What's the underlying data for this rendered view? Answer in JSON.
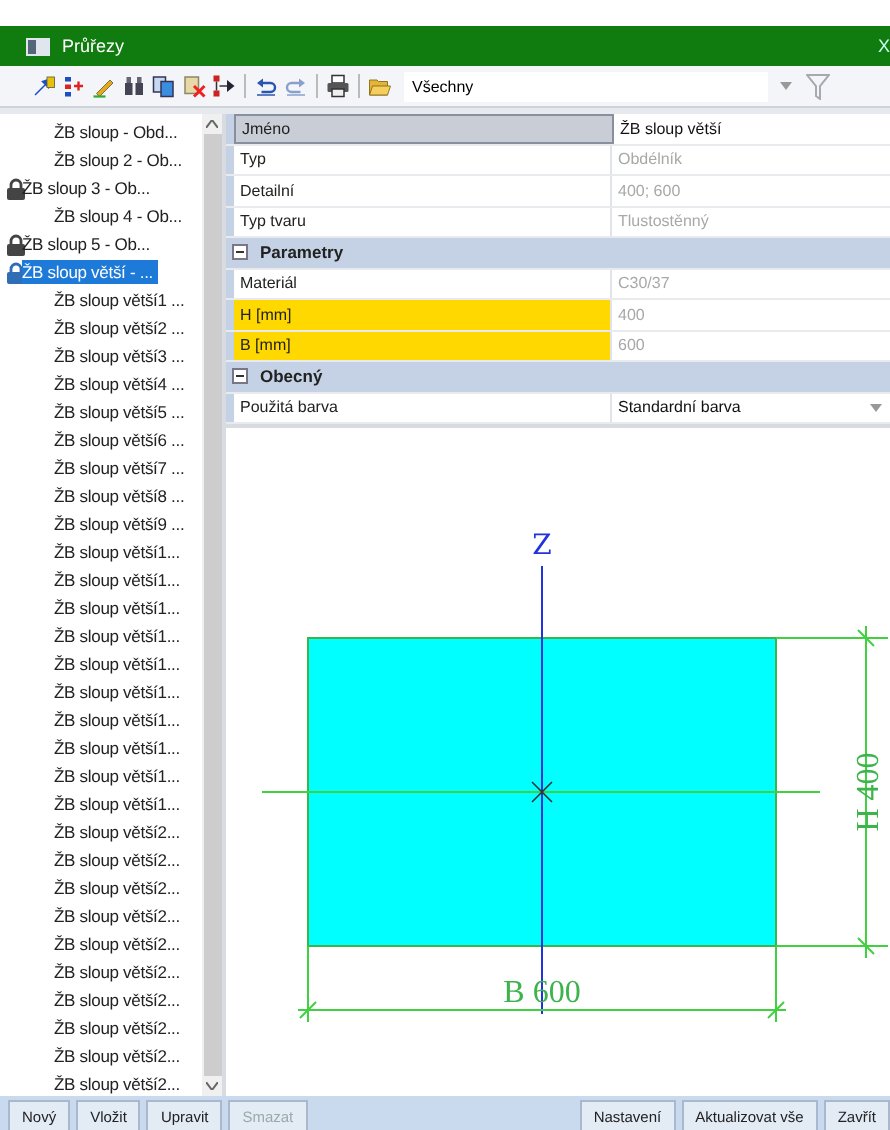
{
  "window": {
    "title": "Průřezy",
    "close": "X"
  },
  "toolbar": {
    "icons": [
      {
        "kind": "pin"
      },
      {
        "kind": "split"
      },
      {
        "kind": "pencil"
      },
      {
        "kind": "binoculars"
      },
      {
        "kind": "copy"
      },
      {
        "kind": "delete"
      },
      {
        "kind": "tree"
      },
      {
        "kind": "sep"
      },
      {
        "kind": "undo"
      },
      {
        "kind": "redo"
      },
      {
        "kind": "sep"
      },
      {
        "kind": "printer"
      },
      {
        "kind": "sep"
      },
      {
        "kind": "folder"
      }
    ],
    "filter": {
      "value": "Všechny"
    }
  },
  "list": [
    {
      "label": "ŽB sloup - Obd...",
      "locked": false,
      "selected": false
    },
    {
      "label": "ŽB sloup 2 - Ob...",
      "locked": false,
      "selected": false
    },
    {
      "label": "ŽB sloup 3 - Ob...",
      "locked": true,
      "selected": false
    },
    {
      "label": "ŽB sloup 4 - Ob...",
      "locked": false,
      "selected": false
    },
    {
      "label": "ŽB sloup 5 - Ob...",
      "locked": true,
      "selected": false
    },
    {
      "label": "ŽB sloup větší - ...",
      "locked": true,
      "selected": true
    },
    {
      "label": "ŽB sloup větší1 ...",
      "locked": false,
      "selected": false
    },
    {
      "label": "ŽB sloup větší2 ...",
      "locked": false,
      "selected": false
    },
    {
      "label": "ŽB sloup větší3 ...",
      "locked": false,
      "selected": false
    },
    {
      "label": "ŽB sloup větší4 ...",
      "locked": false,
      "selected": false
    },
    {
      "label": "ŽB sloup větší5 ...",
      "locked": false,
      "selected": false
    },
    {
      "label": "ŽB sloup větší6 ...",
      "locked": false,
      "selected": false
    },
    {
      "label": "ŽB sloup větší7 ...",
      "locked": false,
      "selected": false
    },
    {
      "label": "ŽB sloup větší8 ...",
      "locked": false,
      "selected": false
    },
    {
      "label": "ŽB sloup větší9 ...",
      "locked": false,
      "selected": false
    },
    {
      "label": "ŽB sloup větší1...",
      "locked": false,
      "selected": false
    },
    {
      "label": "ŽB sloup větší1...",
      "locked": false,
      "selected": false
    },
    {
      "label": "ŽB sloup větší1...",
      "locked": false,
      "selected": false
    },
    {
      "label": "ŽB sloup větší1...",
      "locked": false,
      "selected": false
    },
    {
      "label": "ŽB sloup větší1...",
      "locked": false,
      "selected": false
    },
    {
      "label": "ŽB sloup větší1...",
      "locked": false,
      "selected": false
    },
    {
      "label": "ŽB sloup větší1...",
      "locked": false,
      "selected": false
    },
    {
      "label": "ŽB sloup větší1...",
      "locked": false,
      "selected": false
    },
    {
      "label": "ŽB sloup větší1...",
      "locked": false,
      "selected": false
    },
    {
      "label": "ŽB sloup větší1...",
      "locked": false,
      "selected": false
    },
    {
      "label": "ŽB sloup větší2...",
      "locked": false,
      "selected": false
    },
    {
      "label": "ŽB sloup větší2...",
      "locked": false,
      "selected": false
    },
    {
      "label": "ŽB sloup větší2...",
      "locked": false,
      "selected": false
    },
    {
      "label": "ŽB sloup větší2...",
      "locked": false,
      "selected": false
    },
    {
      "label": "ŽB sloup větší2...",
      "locked": false,
      "selected": false
    },
    {
      "label": "ŽB sloup větší2...",
      "locked": false,
      "selected": false
    },
    {
      "label": "ŽB sloup větší2...",
      "locked": false,
      "selected": false
    },
    {
      "label": "ŽB sloup větší2...",
      "locked": false,
      "selected": false
    },
    {
      "label": "ŽB sloup větší2...",
      "locked": false,
      "selected": false
    },
    {
      "label": "ŽB sloup větší2...",
      "locked": false,
      "selected": false
    }
  ],
  "properties": [
    {
      "kind": "row",
      "name": "Jméno",
      "value": "ŽB sloup větší",
      "selected": true,
      "highlighted": false,
      "readonly": false
    },
    {
      "kind": "row",
      "name": "Typ",
      "value": "Obdélník",
      "selected": false,
      "highlighted": false,
      "readonly": true
    },
    {
      "kind": "row",
      "name": "Detailní",
      "value": "400; 600",
      "selected": false,
      "highlighted": false,
      "readonly": true
    },
    {
      "kind": "row",
      "name": "Typ tvaru",
      "value": "Tlustostěnný",
      "selected": false,
      "highlighted": false,
      "readonly": true
    },
    {
      "kind": "group",
      "name": "Parametry",
      "expanded": true
    },
    {
      "kind": "row",
      "name": "Materiál",
      "value": "C30/37",
      "selected": false,
      "highlighted": false,
      "readonly": true
    },
    {
      "kind": "row",
      "name": "H [mm]",
      "value": "400",
      "selected": false,
      "highlighted": true,
      "readonly": true
    },
    {
      "kind": "row",
      "name": "B [mm]",
      "value": "600",
      "selected": false,
      "highlighted": true,
      "readonly": true
    },
    {
      "kind": "group",
      "name": "Obecný",
      "expanded": true
    },
    {
      "kind": "dropdown",
      "name": "Použitá barva",
      "value": "Standardní barva",
      "selected": false,
      "highlighted": false,
      "readonly": false
    }
  ],
  "drawing": {
    "axis_label": "Z",
    "width_label": "B 600",
    "height_label": "H 400"
  },
  "buttons": [
    {
      "label": "Nový",
      "disabled": false
    },
    {
      "label": "Vložit",
      "disabled": false
    },
    {
      "label": "Upravit",
      "disabled": false
    },
    {
      "label": "Smazat",
      "disabled": true
    }
  ],
  "right_buttons": [
    {
      "label": "Nastavení",
      "disabled": false
    },
    {
      "label": "Aktualizovat vše",
      "disabled": false
    },
    {
      "label": "Zavřít",
      "disabled": false
    }
  ]
}
